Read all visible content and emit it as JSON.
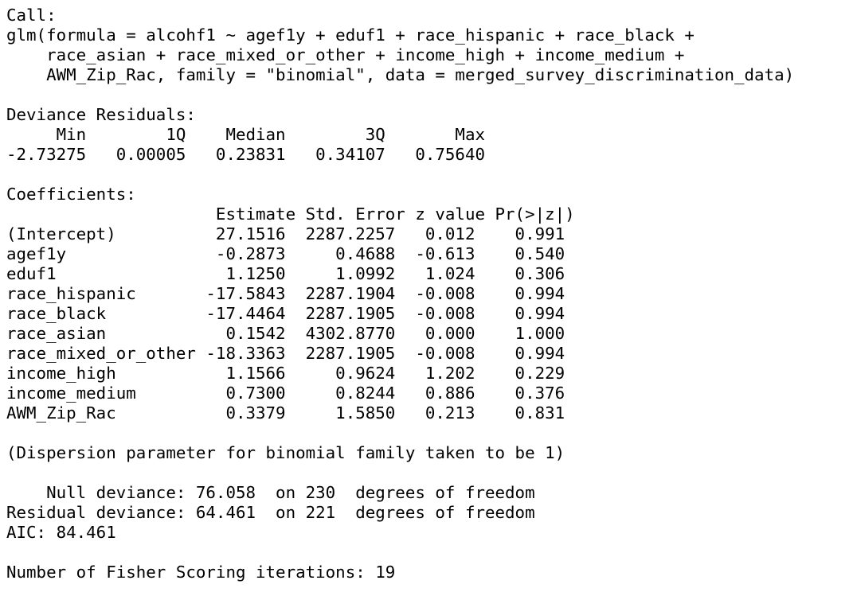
{
  "output": {
    "call_header": "Call:",
    "call_lines": [
      "glm(formula = alcohf1 ~ agef1y + eduf1 + race_hispanic + race_black + ",
      "    race_asian + race_mixed_or_other + income_high + income_medium + ",
      "    AWM_Zip_Rac, family = \"binomial\", data = merged_survey_discrimination_data)"
    ],
    "deviance_residuals": {
      "header": "Deviance Residuals: ",
      "labels_line": "     Min        1Q    Median        3Q       Max  ",
      "values_line": "-2.73275   0.00005   0.23831   0.34107   0.75640  "
    },
    "coefficients": {
      "header": "Coefficients:",
      "column_header_line": "                     Estimate Std. Error z value Pr(>|z|)",
      "rows": [
        "(Intercept)          27.1516  2287.2257   0.012    0.991",
        "agef1y               -0.2873     0.4688  -0.613    0.540",
        "eduf1                 1.1250     1.0992   1.024    0.306",
        "race_hispanic       -17.5843  2287.1904  -0.008    0.994",
        "race_black          -17.4464  2287.1905  -0.008    0.994",
        "race_asian            0.1542  4302.8770   0.000    1.000",
        "race_mixed_or_other -18.3363  2287.1905  -0.008    0.994",
        "income_high           1.1566     0.9624   1.202    0.229",
        "income_medium         0.7300     0.8244   0.886    0.376",
        "AWM_Zip_Rac           0.3379     1.5850   0.213    0.831"
      ]
    },
    "dispersion_line": "(Dispersion parameter for binomial family taken to be 1)",
    "deviance_lines": [
      "    Null deviance: 76.058  on 230  degrees of freedom",
      "Residual deviance: 64.461  on 221  degrees of freedom"
    ],
    "aic_line": "AIC: 84.461",
    "iterations_line": "Number of Fisher Scoring iterations: 19"
  }
}
